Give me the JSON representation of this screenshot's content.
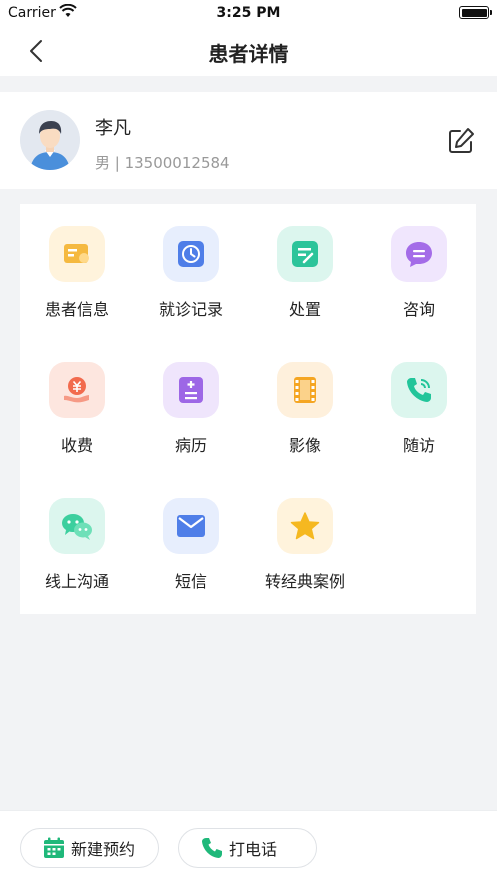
{
  "status_bar": {
    "carrier": "Carrier",
    "time": "3:25 PM"
  },
  "header": {
    "title": "患者详情"
  },
  "patient": {
    "name": "李凡",
    "meta": "男 | 13500012584"
  },
  "grid": [
    {
      "label": "患者信息",
      "icon": "id-card-icon",
      "color": "#f5b940",
      "bg": "#fff3dc"
    },
    {
      "label": "就诊记录",
      "icon": "clock-icon",
      "color": "#4f7ee8",
      "bg": "#e7eefd"
    },
    {
      "label": "处置",
      "icon": "prescription-icon",
      "color": "#2cc49a",
      "bg": "#dcf6ee"
    },
    {
      "label": "咨询",
      "icon": "chat-bubble-icon",
      "color": "#a46ce8",
      "bg": "#f0e6fd"
    },
    {
      "label": "收费",
      "icon": "payment-icon",
      "color": "#f26b4e",
      "bg": "#fde6df"
    },
    {
      "label": "病历",
      "icon": "medical-record-icon",
      "color": "#9d67e6",
      "bg": "#efe5fc"
    },
    {
      "label": "影像",
      "icon": "film-icon",
      "color": "#f5a623",
      "bg": "#fef0dc"
    },
    {
      "label": "随访",
      "icon": "phone-call-icon",
      "color": "#22c59a",
      "bg": "#dcf6ee"
    },
    {
      "label": "线上沟通",
      "icon": "wechat-icon",
      "color": "#3ccf9e",
      "bg": "#dcf6ee"
    },
    {
      "label": "短信",
      "icon": "envelope-icon",
      "color": "#4f7ee8",
      "bg": "#e7eefd"
    },
    {
      "label": "转经典案例",
      "icon": "star-icon",
      "color": "#f5b820",
      "bg": "#fff3dc"
    }
  ],
  "bottom": {
    "new_appointment": "新建预约",
    "call": "打电话"
  },
  "colors": {
    "accent_green": "#1fb87a",
    "page_bg": "#f2f3f5"
  }
}
